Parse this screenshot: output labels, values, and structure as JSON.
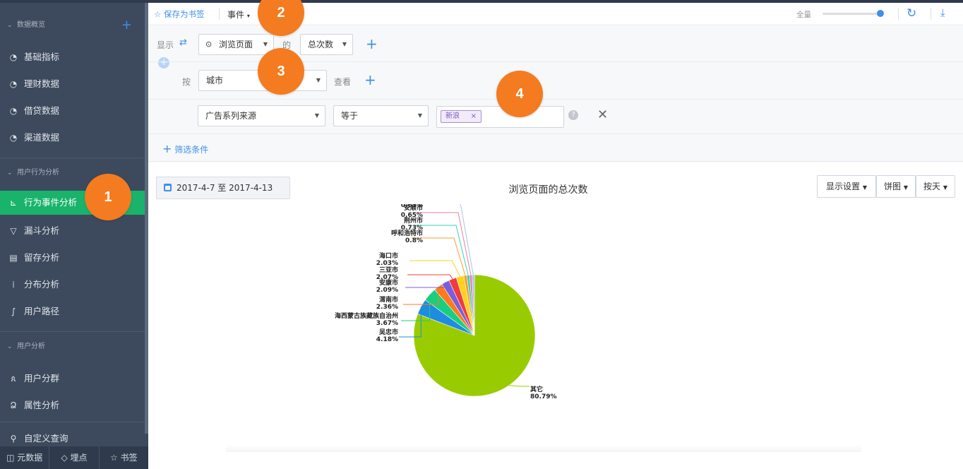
{
  "sidebar": {
    "group1": "数据概览",
    "items1": [
      "基础指标",
      "理财数据",
      "借贷数据",
      "渠道数据"
    ],
    "group2": "用户行为分析",
    "items2": [
      "行为事件分析",
      "漏斗分析",
      "留存分析",
      "分布分析",
      "用户路径"
    ],
    "group3": "用户分析",
    "items3": [
      "用户分群",
      "属性分析"
    ],
    "item_custom": "自定义查询",
    "bottom": [
      "元数据",
      "埋点",
      "书签"
    ]
  },
  "toolbar": {
    "save_bookmark": "保存为书签",
    "event": "事件",
    "full": "全量"
  },
  "config": {
    "show_label": "显示",
    "event_select": "浏览页面",
    "of_label": "的",
    "metric_select": "总次数",
    "by_label": "按",
    "group_select": "城市",
    "view_label": "查看",
    "filter_field": "广告系列来源",
    "filter_op": "等于",
    "filter_tag": "新浪",
    "add_filter": "筛选条件"
  },
  "chart_header": {
    "date_range": "2017-4-7 至 2017-4-13",
    "title": "浏览页面的总次数",
    "display_settings": "显示设置",
    "chart_type": "饼图",
    "by_day": "按天"
  },
  "callouts": [
    "1",
    "2",
    "3",
    "4"
  ],
  "chart_data": {
    "type": "pie",
    "title": "浏览页面的总次数",
    "labels": [
      "其它",
      "吴忠市",
      "海西蒙古族藏族自治州",
      "渭南市",
      "安康市",
      "三亚市",
      "海口市",
      "呼和浩特市",
      "荆州市",
      "安顺市",
      ""
    ],
    "values": [
      80.79,
      4.18,
      3.67,
      2.36,
      2.09,
      2.07,
      2.03,
      0.8,
      0.73,
      0.65,
      0.63
    ],
    "value_labels": [
      "80.79%",
      "4.18%",
      "3.67%",
      "2.36%",
      "2.09%",
      "2.07%",
      "2.03%",
      "0.8%",
      "0.73%",
      "0.65%",
      "0.63%"
    ],
    "colors": [
      "#99cc00",
      "#1f8ce0",
      "#19cf7f",
      "#ff7a1a",
      "#7a5fdc",
      "#f03c3c",
      "#ffd21e",
      "#ff9a2e",
      "#35d6b0",
      "#f07b9b",
      "#9fc6ef"
    ]
  }
}
